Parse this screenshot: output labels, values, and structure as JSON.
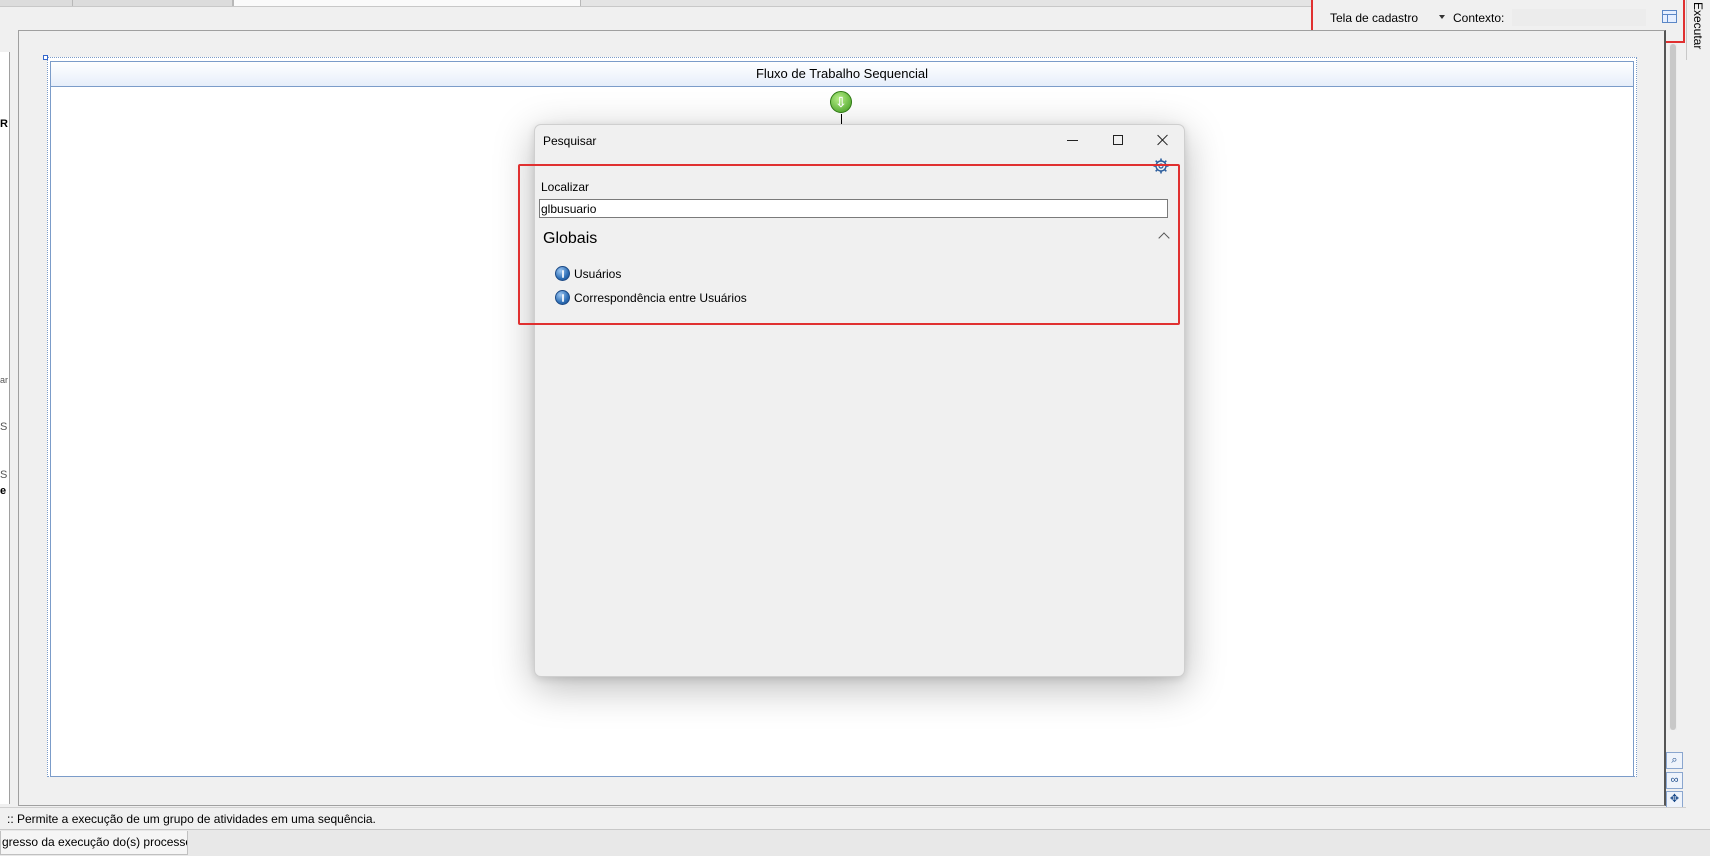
{
  "context_toolbar": {
    "screen_dropdown": "Tela de cadastro",
    "context_label": "Contexto:",
    "context_value": ""
  },
  "side_tab": {
    "label": "Executar"
  },
  "designer": {
    "sequence_title": "Fluxo de Trabalho Sequencial"
  },
  "left_panel": {
    "fragments": [
      "R",
      "ar",
      "S",
      "S",
      "e"
    ]
  },
  "dialog": {
    "title": "Pesquisar",
    "find_label": "Localizar",
    "search_value": "glbusuario",
    "group_title": "Globais",
    "results": [
      {
        "label": "Usuários",
        "icon": "globe-icon"
      },
      {
        "label": "Correspondência entre Usuários",
        "icon": "globe-icon"
      }
    ]
  },
  "status": {
    "text": ":: Permite a execução de um grupo de atividades em uma sequência."
  },
  "bottom_tab": {
    "label": "gresso da execução do(s) processo(s)"
  },
  "colors": {
    "highlight": "#e03030",
    "sequence_border": "#7b9cc9",
    "start_icon": "#3e9e1c"
  }
}
